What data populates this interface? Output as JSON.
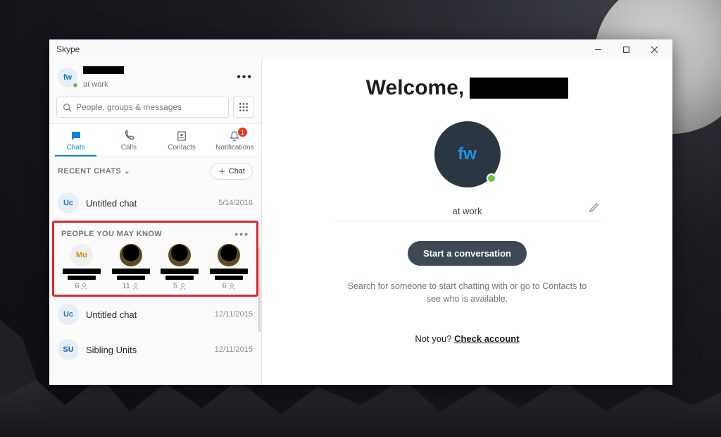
{
  "window": {
    "title": "Skype"
  },
  "profile": {
    "initials": "fw",
    "status": "at work"
  },
  "search": {
    "placeholder": "People, groups & messages"
  },
  "tabs": {
    "chats": "Chats",
    "calls": "Calls",
    "contacts": "Contacts",
    "notifications": "Notifications",
    "notif_badge": "1"
  },
  "sections": {
    "recent": "RECENT CHATS",
    "new_chat": "Chat",
    "pymk": "PEOPLE YOU MAY KNOW"
  },
  "chats": [
    {
      "avatar": "Uc",
      "title": "Untitled chat",
      "date": "5/14/2016"
    },
    {
      "avatar": "Uc",
      "title": "Untitled chat",
      "date": "12/11/2015"
    },
    {
      "avatar": "SU",
      "title": "Sibling Units",
      "date": "12/11/2015"
    }
  ],
  "pymk": [
    {
      "initials": "Mu",
      "mutual": "6"
    },
    {
      "initials": "",
      "mutual": "11"
    },
    {
      "initials": "",
      "mutual": "5"
    },
    {
      "initials": "",
      "mutual": "6"
    }
  ],
  "main": {
    "welcome_prefix": "Welcome,",
    "avatar_initials": "fw",
    "status_text": "at work",
    "cta": "Start a conversation",
    "hint": "Search for someone to start chatting with or go to Contacts to see who is available.",
    "notyou_prefix": "Not you? ",
    "notyou_link": "Check account"
  }
}
